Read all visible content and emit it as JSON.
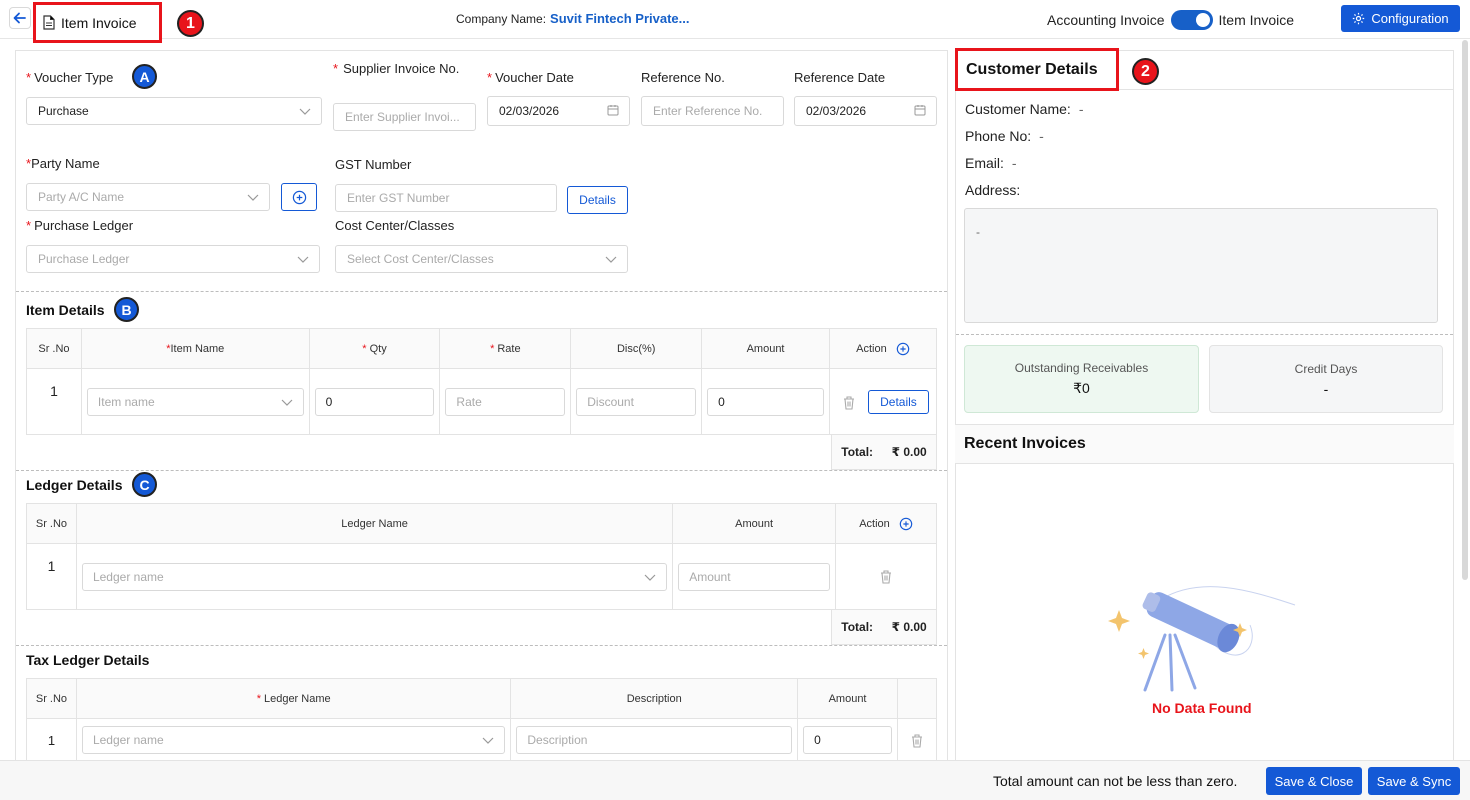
{
  "header": {
    "title": "Item Invoice",
    "company_label": "Company Name:",
    "company_name": "Suvit Fintech Private...",
    "toggle_left": "Accounting Invoice",
    "toggle_right": "Item Invoice",
    "config_label": "Configuration",
    "annot_1": "1",
    "annot_2": "2"
  },
  "form": {
    "voucher_type": {
      "label": "Voucher Type",
      "value": "Purchase",
      "badge": "A"
    },
    "supplier_invoice": {
      "label": "Supplier Invoice No.",
      "placeholder": "Enter  Supplier Invoi..."
    },
    "voucher_date": {
      "label": "Voucher Date",
      "value": "02/03/2026"
    },
    "reference_no": {
      "label": "Reference No.",
      "placeholder": "Enter Reference No."
    },
    "reference_date": {
      "label": "Reference Date",
      "value": "02/03/2026"
    },
    "party_name": {
      "label": "Party Name",
      "placeholder": "Party A/C Name"
    },
    "gst_number": {
      "label": "GST Number",
      "placeholder": "Enter GST Number",
      "details": "Details"
    },
    "purchase_ledger": {
      "label": "Purchase Ledger",
      "placeholder": "Purchase Ledger"
    },
    "cost_center": {
      "label": "Cost Center/Classes",
      "placeholder": "Select Cost Center/Classes"
    }
  },
  "item_details": {
    "title": "Item Details",
    "badge": "B",
    "columns": [
      "Sr .No",
      "Item Name",
      "Qty",
      "Rate",
      "Disc(%)",
      "Amount",
      "Action"
    ],
    "row": {
      "sr": "1",
      "item_ph": "Item name",
      "qty": "0",
      "rate_ph": "Rate",
      "disc_ph": "Discount",
      "amount": "0",
      "details": "Details"
    },
    "total_label": "Total:",
    "total_value": "₹ 0.00"
  },
  "ledger_details": {
    "title": "Ledger Details",
    "badge": "C",
    "columns": [
      "Sr .No",
      "Ledger Name",
      "Amount",
      "Action"
    ],
    "row": {
      "sr": "1",
      "ledger_ph": "Ledger name",
      "amount_ph": "Amount"
    },
    "total_label": "Total:",
    "total_value": "₹ 0.00"
  },
  "tax_ledger": {
    "title": "Tax Ledger Details",
    "columns": [
      "Sr .No",
      "Ledger Name",
      "Description",
      "Amount"
    ],
    "row": {
      "sr": "1",
      "ledger_ph": "Ledger name",
      "desc_ph": "Description",
      "amount": "0"
    }
  },
  "customer": {
    "title": "Customer Details",
    "name_label": "Customer Name:",
    "name_value": "-",
    "phone_label": "Phone No:",
    "phone_value": "-",
    "email_label": "Email:",
    "email_value": "-",
    "address_label": "Address:",
    "address_value": "-",
    "outstanding_label": "Outstanding Receivables",
    "outstanding_value": "₹0",
    "credit_label": "Credit Days",
    "credit_value": "-"
  },
  "recent": {
    "title": "Recent Invoices",
    "empty": "No Data Found"
  },
  "footer": {
    "message": "Total amount can not be less than zero.",
    "save_close": "Save & Close",
    "save_sync": "Save & Sync"
  },
  "colors": {
    "primary": "#1459d6",
    "danger": "#e8141b",
    "success_bg": "#eef8f1"
  }
}
